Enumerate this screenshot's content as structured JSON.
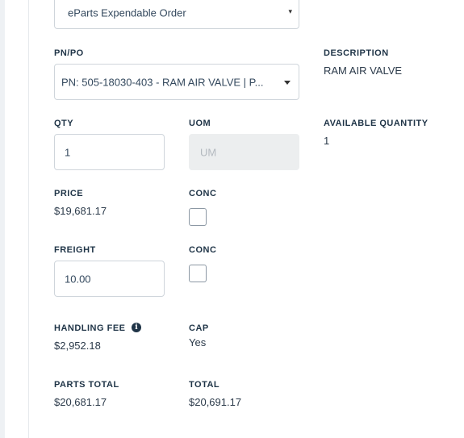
{
  "order_type": {
    "value": "eParts Expendable Order",
    "caret": "▾"
  },
  "pnpo": {
    "label": "PN/PO",
    "value": "PN: 505-18030-403 - RAM AIR VALVE | P..."
  },
  "description": {
    "label": "DESCRIPTION",
    "value": "RAM AIR VALVE"
  },
  "qty": {
    "label": "QTY",
    "value": "1"
  },
  "uom": {
    "label": "UOM",
    "placeholder": "UM"
  },
  "available_quantity": {
    "label": "AVAILABLE QUANTITY",
    "value": "1"
  },
  "price": {
    "label": "PRICE",
    "value": "$19,681.17"
  },
  "conc_price": {
    "label": "CONC",
    "checked": false
  },
  "freight": {
    "label": "FREIGHT",
    "value": "10.00"
  },
  "conc_freight": {
    "label": "CONC",
    "checked": false
  },
  "handling_fee": {
    "label": "HANDLING FEE",
    "value": "$2,952.18",
    "info_icon": "i"
  },
  "cap": {
    "label": "CAP",
    "value": "Yes"
  },
  "parts_total": {
    "label": "PARTS TOTAL",
    "value": "$20,681.17"
  },
  "total": {
    "label": "TOTAL",
    "value": "$20,691.17"
  }
}
